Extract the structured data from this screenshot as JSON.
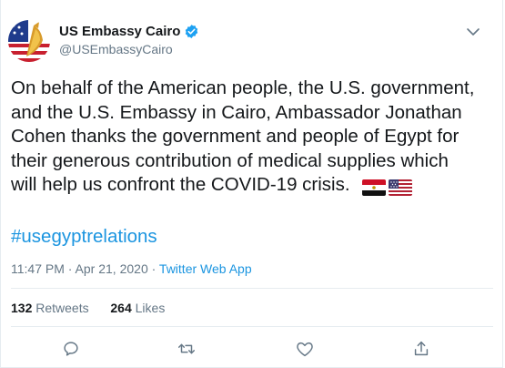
{
  "account": {
    "name": "US Embassy Cairo",
    "handle": "@USEmbassyCairo"
  },
  "tweet": {
    "text": "On behalf of the American people, the U.S. government,\nand the U.S. Embassy in Cairo, Ambassador Jonathan\nCohen thanks the government and people of Egypt for\ntheir generous contribution of medical supplies which\nwill help us confront the COVID-19 crisis.",
    "emojis": [
      "egypt-flag",
      "us-flag"
    ],
    "hashtag": "#usegyptrelations",
    "timestamp": "11:47 PM · Apr 21, 2020 · ",
    "source": "Twitter Web App"
  },
  "stats": {
    "retweets_count": "132",
    "retweets_label": " Retweets",
    "likes_count": "264",
    "likes_label": " Likes"
  },
  "colors": {
    "link": "#1b95e0",
    "secondary_text": "#657786",
    "verified": "#1da1f2"
  }
}
